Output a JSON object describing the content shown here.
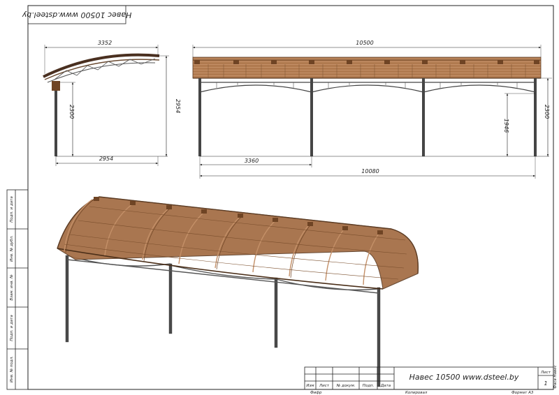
{
  "stamp_title_rotated": "Навес 10500 www.dsteel.by",
  "side_view": {
    "width_top": "3352",
    "height_total": "2954",
    "height_post": "2300",
    "width_bottom": "2954"
  },
  "front_view": {
    "length_top": "10500",
    "height_post": "2300",
    "height_clear": "1946",
    "span": "3360",
    "length_bottom": "10080"
  },
  "side_stamp": [
    "Подп. и дата",
    "Инв. № дубл.",
    "Взам. инв. №",
    "Подп. и дата",
    "Инв. № подл."
  ],
  "title_block": {
    "drawing_title": "Навес 10500 www.dsteel.by",
    "col_headers": [
      "Изм",
      "Лист",
      "№ докум.",
      "Подп.",
      "Дата"
    ],
    "sheet_label": "Лист",
    "sheet_number": "1",
    "side_label": "Фаса Навес",
    "footer_left": "Фифр",
    "footer_copied": "Копировал",
    "footer_format": "Формат А3"
  },
  "colors": {
    "roof": "#a26b42",
    "roof_dark": "#6f4424",
    "roof_light": "#c49068",
    "steel": "#454545",
    "line": "#2a2a2a"
  }
}
